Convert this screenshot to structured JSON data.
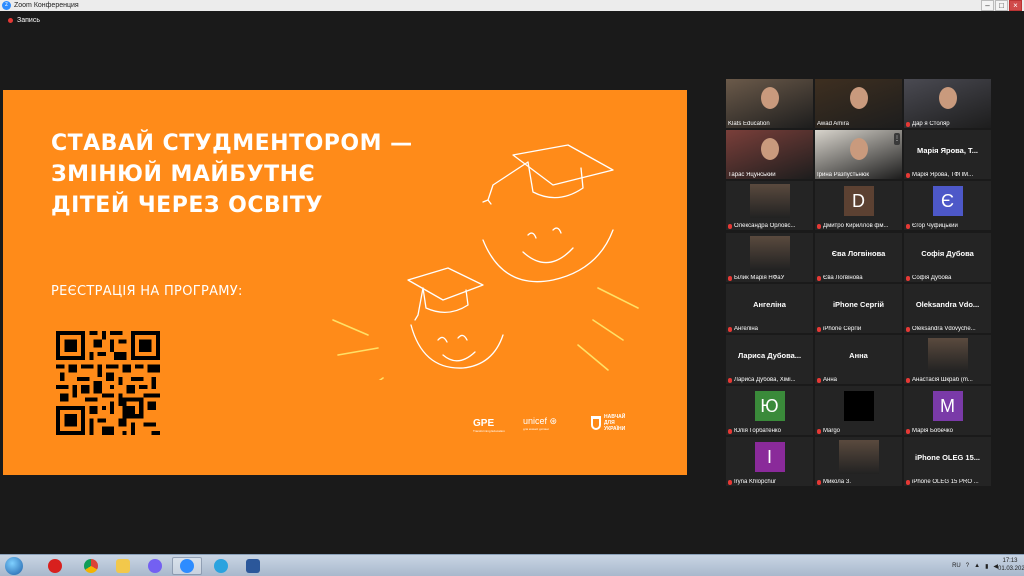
{
  "window": {
    "title": "Zoom Конференция",
    "controls": [
      "–",
      "□",
      "×"
    ]
  },
  "recording": {
    "label": "Запись"
  },
  "slide": {
    "title_lines": [
      "СТАВАЙ СТУДМЕНТОРОМ —",
      "ЗМІНЮЙ МАЙБУТНЄ",
      "ДІТЕЙ ЧЕРЕЗ ОСВІТУ"
    ],
    "registration": "РЕЄСТРАЦІЯ НА ПРОГРАМУ:",
    "logos": {
      "gpe": "GPE",
      "gpe_sub": "Transforming Education",
      "unicef": "unicef",
      "unicef_sub": "для кожної дитини",
      "navchai": [
        "НАВЧАЙ",
        "ДЛЯ",
        "УКРАЇНИ"
      ]
    },
    "colors": {
      "background": "#ff8b19",
      "art_line": "#ffffff",
      "sparks": "#ffe066"
    }
  },
  "participants": [
    {
      "name": "Klats Education",
      "kind": "video",
      "muted": false
    },
    {
      "name": "Awad Amira",
      "kind": "video",
      "muted": false
    },
    {
      "name": "Дар я Столяр",
      "kind": "video",
      "muted": true
    },
    {
      "name": "Тарас Яцунський",
      "kind": "video",
      "muted": false,
      "active": true
    },
    {
      "name": "Ірина Разпустьнюк",
      "kind": "video",
      "muted": false
    },
    {
      "name": "Марія Ярова, ТФПМ...",
      "display": "Марія Ярова, Т...",
      "kind": "name",
      "muted": true
    },
    {
      "name": "Олександра Орловс...",
      "kind": "photo",
      "muted": true
    },
    {
      "name": "Дмитро Кириллов фм...",
      "kind": "avatar",
      "letter": "D",
      "color": "#5c4132",
      "muted": true
    },
    {
      "name": "Єгор Чуфицький",
      "kind": "avatar",
      "letter": "Є",
      "color": "#4d58c8",
      "muted": true
    },
    {
      "name": "Білик Марія НФаУ",
      "kind": "photo",
      "muted": true
    },
    {
      "name": "Єва Логвінова",
      "display": "Єва Логвінова",
      "kind": "name",
      "muted": true
    },
    {
      "name": "Софія Дубова",
      "display": "Софія Дубова",
      "kind": "name",
      "muted": true
    },
    {
      "name": "Ангеліна",
      "display": "Ангеліна",
      "kind": "name",
      "muted": true
    },
    {
      "name": "iPhone Сергій",
      "display": "iPhone Сергій",
      "kind": "name",
      "muted": true
    },
    {
      "name": "Oleksandra Vdovyche...",
      "display": "Oleksandra Vdo...",
      "kind": "name",
      "muted": true
    },
    {
      "name": "Лариса Дубова, Хімі...",
      "display": "Лариса Дубова...",
      "kind": "name",
      "muted": true
    },
    {
      "name": "Анна",
      "display": "Анна",
      "kind": "name",
      "muted": true
    },
    {
      "name": "Анастасія Шкраб (m...",
      "kind": "photo",
      "muted": true
    },
    {
      "name": "Юлія Горбатенко",
      "kind": "avatar",
      "letter": "Ю",
      "color": "#3a8a3a",
      "muted": true
    },
    {
      "name": "Margo",
      "kind": "avatar",
      "letter": "",
      "color": "#000000",
      "muted": true
    },
    {
      "name": "Марія Бобечко",
      "kind": "avatar",
      "letter": "М",
      "color": "#7a3aa8",
      "muted": true
    },
    {
      "name": "Iryna Khlopchur",
      "kind": "avatar",
      "letter": "I",
      "color": "#8a2a9a",
      "muted": true
    },
    {
      "name": "Микола З.",
      "kind": "photo",
      "muted": true
    },
    {
      "name": "iPhone OLEG 15 PRO ...",
      "display": "iPhone OLEG 15...",
      "kind": "name",
      "muted": true
    }
  ],
  "taskbar": {
    "apps": [
      "chrome-icon",
      "folder-icon",
      "viber-icon",
      "zoom-icon",
      "telegram-icon",
      "word-icon"
    ],
    "tray": {
      "lang": "RU"
    },
    "clock": {
      "time": "17:13",
      "date": "01.03.2025"
    }
  }
}
